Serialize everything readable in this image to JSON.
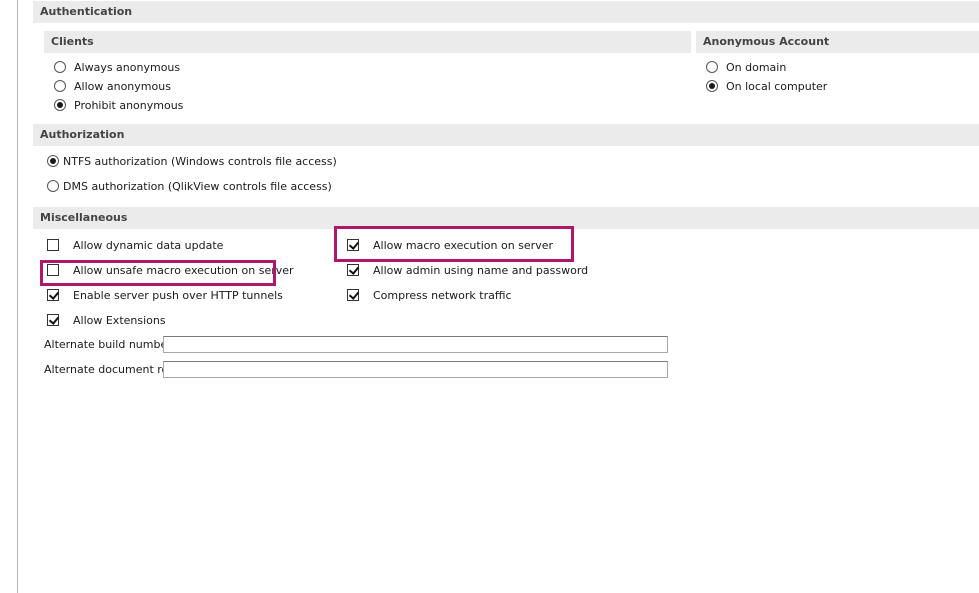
{
  "authentication": {
    "title": "Authentication",
    "clients": {
      "title": "Clients",
      "options": [
        {
          "label": "Always anonymous",
          "selected": false
        },
        {
          "label": "Allow anonymous",
          "selected": false
        },
        {
          "label": "Prohibit anonymous",
          "selected": true
        }
      ]
    },
    "anonymous_account": {
      "title": "Anonymous Account",
      "options": [
        {
          "label": "On domain",
          "selected": false
        },
        {
          "label": "On local computer",
          "selected": true
        }
      ]
    }
  },
  "authorization": {
    "title": "Authorization",
    "options": [
      {
        "label": "NTFS authorization (Windows controls file access)",
        "selected": true
      },
      {
        "label": "DMS authorization (QlikView controls file access)",
        "selected": false
      }
    ]
  },
  "miscellaneous": {
    "title": "Miscellaneous",
    "checkboxes": [
      {
        "label": "Allow dynamic data update",
        "checked": false
      },
      {
        "label": "Allow unsafe macro execution on server",
        "checked": false
      },
      {
        "label": "Enable server push over HTTP tunnels",
        "checked": true
      },
      {
        "label": "Allow Extensions",
        "checked": true
      },
      {
        "label": "Allow macro execution on server",
        "checked": true
      },
      {
        "label": "Allow admin using name and password",
        "checked": true
      },
      {
        "label": "Compress network traffic",
        "checked": true
      }
    ],
    "alternate_build_number": {
      "label": "Alternate build number:",
      "value": ""
    },
    "alternate_document_root": {
      "label": "Alternate document root:",
      "value": ""
    }
  },
  "colors": {
    "highlight": "#b0176a",
    "section_header": "#ebebeb"
  }
}
